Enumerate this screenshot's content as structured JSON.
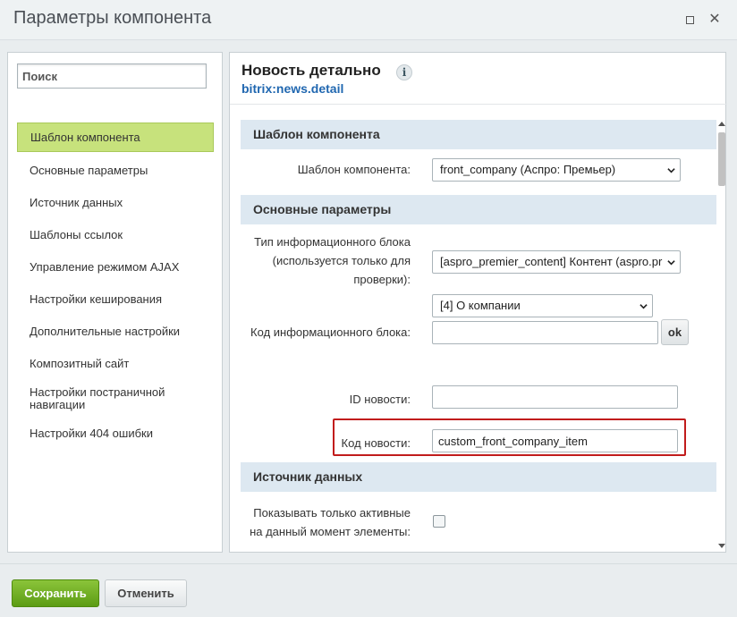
{
  "window": {
    "title": "Параметры компонента",
    "maximize_icon": "maximize-icon",
    "close_icon": "close-icon"
  },
  "sidebar": {
    "search_placeholder": "Поиск",
    "items": [
      {
        "label": "Шаблон компонента",
        "active": true
      },
      {
        "label": "Основные параметры"
      },
      {
        "label": "Источник данных"
      },
      {
        "label": "Шаблоны ссылок"
      },
      {
        "label": "Управление режимом AJAX"
      },
      {
        "label": "Настройки кеширования"
      },
      {
        "label": "Дополнительные настройки"
      },
      {
        "label": "Композитный сайт"
      },
      {
        "label": "Настройки постраничной навигации"
      },
      {
        "label": "Настройки 404 ошибки"
      }
    ],
    "active_color": "#c7e27c"
  },
  "component": {
    "title": "Новость детально",
    "info_icon": "i",
    "code": "bitrix:news.detail",
    "code_color": "#2067b0"
  },
  "sections": {
    "template": {
      "heading": "Шаблон компонента",
      "template_label": "Шаблон компонента:",
      "template_value": "front_company (Аспро: Премьер)"
    },
    "main": {
      "heading": "Основные параметры",
      "iblock_type_label_1": "Тип информационного блока",
      "iblock_type_label_2": "(используется только для",
      "iblock_type_label_3": "проверки):",
      "iblock_type_value": "[aspro_premier_content] Контент (aspro.pr",
      "iblock_select_value": "[4] О компании",
      "iblock_code_label": "Код информационного блока:",
      "iblock_code_value": "",
      "ok_label": "ok",
      "news_id_label": "ID новости:",
      "news_id_value": "",
      "news_code_label": "Код новости:",
      "news_code_value": "custom_front_company_item",
      "highlight_color": "#c11c1c"
    },
    "source": {
      "heading": "Источник данных",
      "active_only_label_1": "Показывать только активные",
      "active_only_label_2": "на данный момент элементы:",
      "active_only_checked": false
    }
  },
  "footer": {
    "save_label": "Сохранить",
    "cancel_label": "Отменить",
    "save_color": "#6fae22"
  }
}
